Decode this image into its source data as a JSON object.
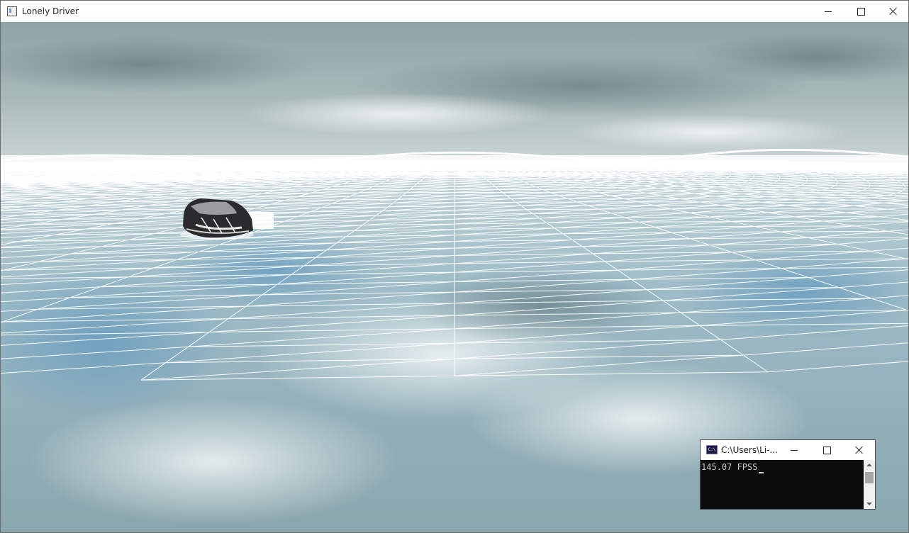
{
  "main_window": {
    "title": "Lonely Driver",
    "icon": "app-window-icon"
  },
  "scene": {
    "description_icons": [
      "sky-skybox",
      "wireframe-terrain",
      "car-model"
    ],
    "colors": {
      "sky_top": "#9fb2b3",
      "sky_horizon": "#bfcdcd",
      "terrain_base": "#8fb0bc",
      "wireframe": "#ffffff"
    }
  },
  "console": {
    "title": "C:\\Users\\Li-...",
    "icon_text": "C:\\",
    "output": "145.07 FPSS"
  }
}
